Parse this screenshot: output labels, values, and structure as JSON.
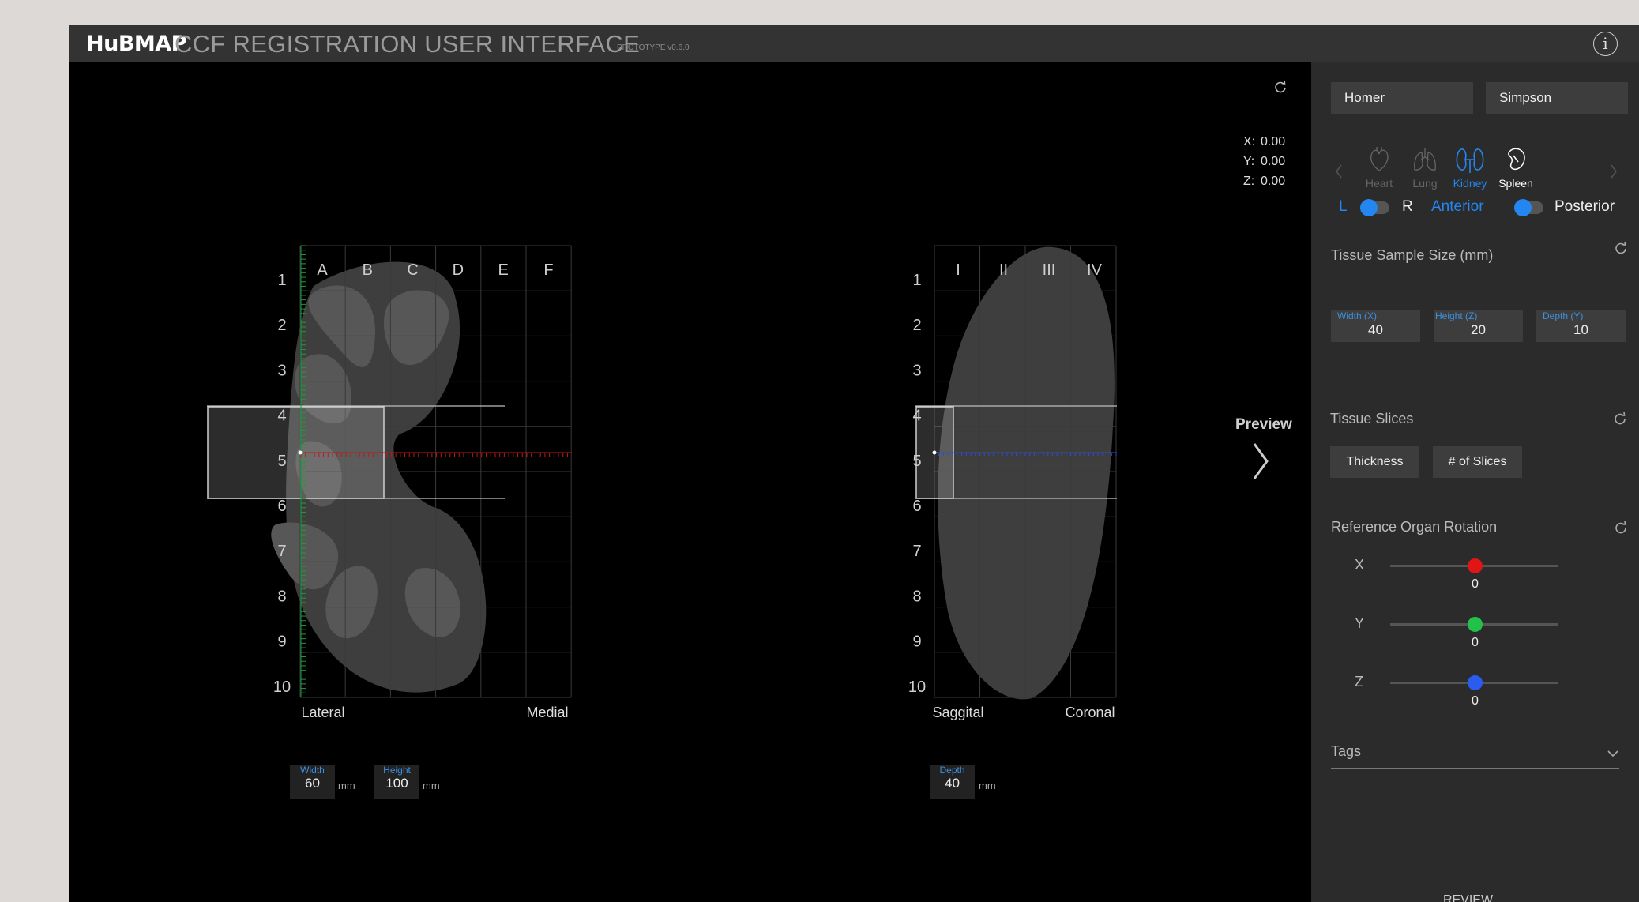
{
  "header": {
    "logo": "HuBMAP",
    "title": "CCF REGISTRATION USER INTERFACE",
    "version": "PROTOTYPE v0.6.0",
    "info_label": "i"
  },
  "viewport": {
    "coords": {
      "x_label": "X:",
      "x": "0.00",
      "y_label": "Y:",
      "y": "0.00",
      "z_label": "Z:",
      "z": "0.00"
    },
    "preview_label": "Preview",
    "front_view": {
      "col_labels": [
        "A",
        "B",
        "C",
        "D",
        "E",
        "F"
      ],
      "row_labels": [
        "1",
        "2",
        "3",
        "4",
        "5",
        "6",
        "7",
        "8",
        "9",
        "10"
      ],
      "bottom_left": "Lateral",
      "bottom_right": "Medial"
    },
    "side_view": {
      "col_labels": [
        "I",
        "II",
        "III",
        "IV"
      ],
      "row_labels": [
        "1",
        "2",
        "3",
        "4",
        "5",
        "6",
        "7",
        "8",
        "9",
        "10"
      ],
      "bottom_left": "Saggital",
      "bottom_right": "Coronal"
    },
    "dimensions": {
      "width_label": "Width",
      "width_value": "60",
      "width_unit": "mm",
      "height_label": "Height",
      "height_value": "100",
      "height_unit": "mm",
      "depth_label": "Depth",
      "depth_value": "40",
      "depth_unit": "mm"
    }
  },
  "sidebar": {
    "first_name": "Homer",
    "last_name": "Simpson",
    "organs": [
      {
        "label": "Heart",
        "icon": "heart-icon",
        "state": "inactive"
      },
      {
        "label": "Lung",
        "icon": "lung-icon",
        "state": "inactive"
      },
      {
        "label": "Kidney",
        "icon": "kidney-icon",
        "state": "selected"
      },
      {
        "label": "Spleen",
        "icon": "spleen-icon",
        "state": "active"
      }
    ],
    "side_toggle": {
      "left": "L",
      "right": "R"
    },
    "face_toggle": {
      "left": "Anterior",
      "right": "Posterior"
    },
    "tissue_size": {
      "title": "Tissue Sample Size  (mm)",
      "width_label": "Width (X)",
      "width": "40",
      "height_label": "Height (Z)",
      "height": "20",
      "depth_label": "Depth (Y)",
      "depth": "10"
    },
    "tissue_slices": {
      "title": "Tissue Slices",
      "thickness_label": "Thickness",
      "count_label": "# of Slices"
    },
    "rotation": {
      "title": "Reference Organ Rotation",
      "x_label": "X",
      "x_value": "0",
      "y_label": "Y",
      "y_value": "0",
      "z_label": "Z",
      "z_value": "0"
    },
    "tags_label": "Tags",
    "review_label": "REVIEW"
  },
  "colors": {
    "accent": "#2486f0",
    "x_axis": "#e01515",
    "y_axis": "#22c24a",
    "z_axis": "#2b5cf0",
    "header_bg": "#333333",
    "sidebar_bg": "#2b2b2b"
  }
}
